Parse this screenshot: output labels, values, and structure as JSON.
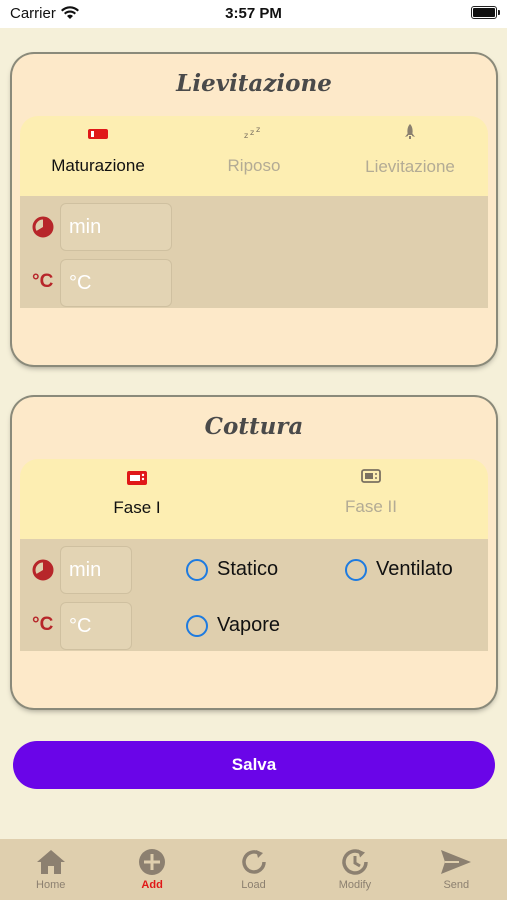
{
  "status_bar": {
    "carrier": "Carrier",
    "time": "3:57 PM"
  },
  "lievitazione": {
    "title": "Lievitazione",
    "tabs": [
      {
        "label": "Maturazione",
        "icon": "fridge-icon",
        "active": true
      },
      {
        "label": "Riposo",
        "icon": "sleep-icon",
        "active": false
      },
      {
        "label": "Lievitazione",
        "icon": "rocket-icon",
        "active": false
      }
    ],
    "time_placeholder": "min",
    "temp_unit": "°C",
    "temp_placeholder": "°C"
  },
  "cottura": {
    "title": "Cottura",
    "tabs": [
      {
        "label": "Fase I",
        "icon": "oven-icon",
        "active": true
      },
      {
        "label": "Fase II",
        "icon": "microwave-icon",
        "active": false
      }
    ],
    "time_placeholder": "min",
    "temp_unit": "°C",
    "temp_placeholder": "°C",
    "options": [
      "Statico",
      "Ventilato",
      "Vapore"
    ]
  },
  "save_label": "Salva",
  "tabbar": [
    {
      "label": "Home",
      "icon": "home-icon",
      "active": false
    },
    {
      "label": "Add",
      "icon": "add-icon",
      "active": true
    },
    {
      "label": "Load",
      "icon": "load-icon",
      "active": false
    },
    {
      "label": "Modify",
      "icon": "modify-icon",
      "active": false
    },
    {
      "label": "Send",
      "icon": "send-icon",
      "active": false
    }
  ],
  "colors": {
    "background": "#f5f0d9",
    "card": "#fde9c9",
    "tab_strip": "#fdeeb2",
    "panel": "#dfcfae",
    "accent_red": "#b7262a",
    "radio_blue": "#1e7be0",
    "save_purple": "#6a05e8"
  }
}
